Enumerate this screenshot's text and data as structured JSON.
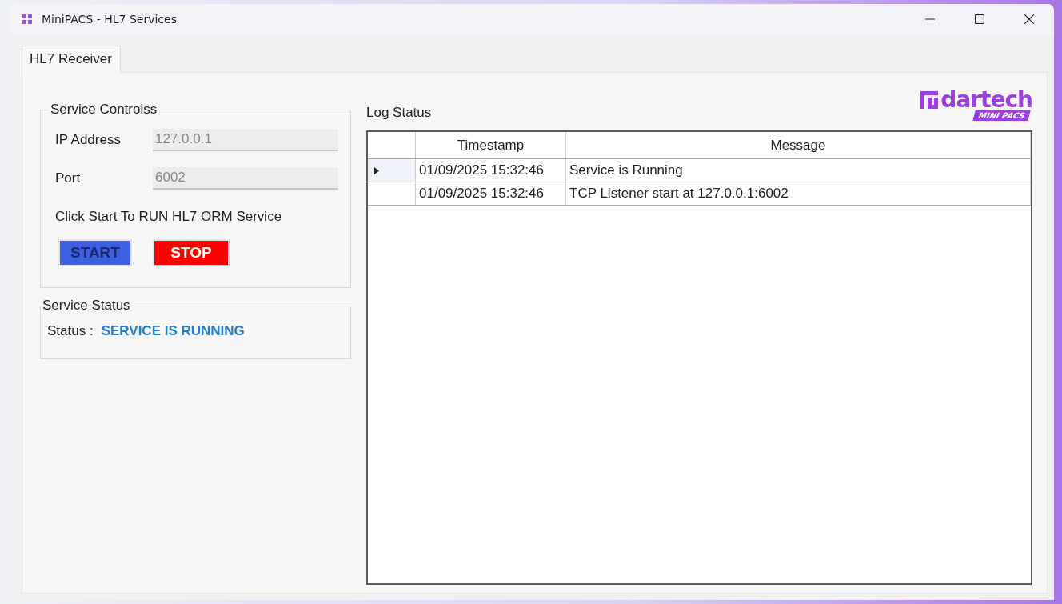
{
  "window": {
    "title": "MiniPACS - HL7 Services"
  },
  "tabs": [
    {
      "label": "HL7 Receiver",
      "selected": true
    }
  ],
  "service_controls": {
    "title": "Service Controlss",
    "fields": [
      {
        "label": "IP Address",
        "value": "127.0.0.1",
        "disabled": true
      },
      {
        "label": "Port",
        "value": "6002",
        "disabled": true
      }
    ],
    "hint": "Click Start To RUN HL7 ORM Service",
    "buttons": [
      {
        "kind": "start",
        "label": "START"
      },
      {
        "kind": "stop",
        "label": "STOP"
      }
    ]
  },
  "service_status": {
    "title": "Service Status",
    "label": "Status :",
    "value": "SERVICE IS RUNNING"
  },
  "log": {
    "title": "Log Status",
    "columns": [
      "Timestamp",
      "Message"
    ],
    "rows": [
      {
        "current": true,
        "cells": [
          "01/09/2025 15:32:46",
          "Service is Running"
        ]
      },
      {
        "current": false,
        "cells": [
          "01/09/2025 15:32:46",
          "TCP Listener start at 127.0.0.1:6002"
        ]
      }
    ]
  },
  "logo": {
    "name": "dartech",
    "tagline": "MINI PACS"
  }
}
